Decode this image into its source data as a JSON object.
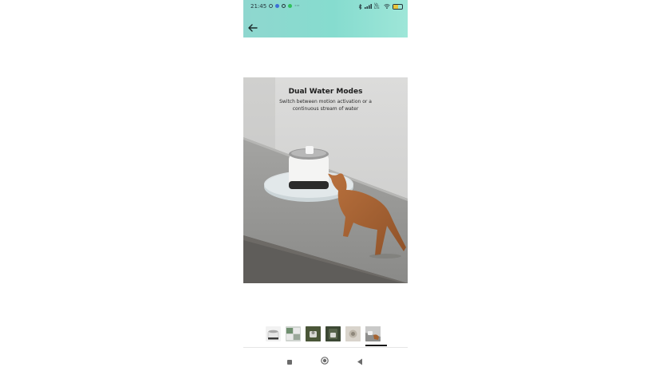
{
  "status_bar": {
    "time": "21:45",
    "network_label": "Vo LTE",
    "battery_level": "55",
    "battery_fraction": 0.55
  },
  "app_bar": {
    "back_icon": "back-arrow-icon",
    "colors": {
      "gradient_start": "#8fd7cf",
      "gradient_end": "#9ee6d8"
    }
  },
  "product_image": {
    "title": "Dual Water Modes",
    "subtitle": "Switch between motion activation or a continuous stream of water"
  },
  "gallery": {
    "thumbnail_count": 6,
    "selected_index": 5
  },
  "nav_bar": {
    "recents_icon": "recents-square-icon",
    "home_icon": "home-circle-icon",
    "back_icon": "back-triangle-icon"
  }
}
